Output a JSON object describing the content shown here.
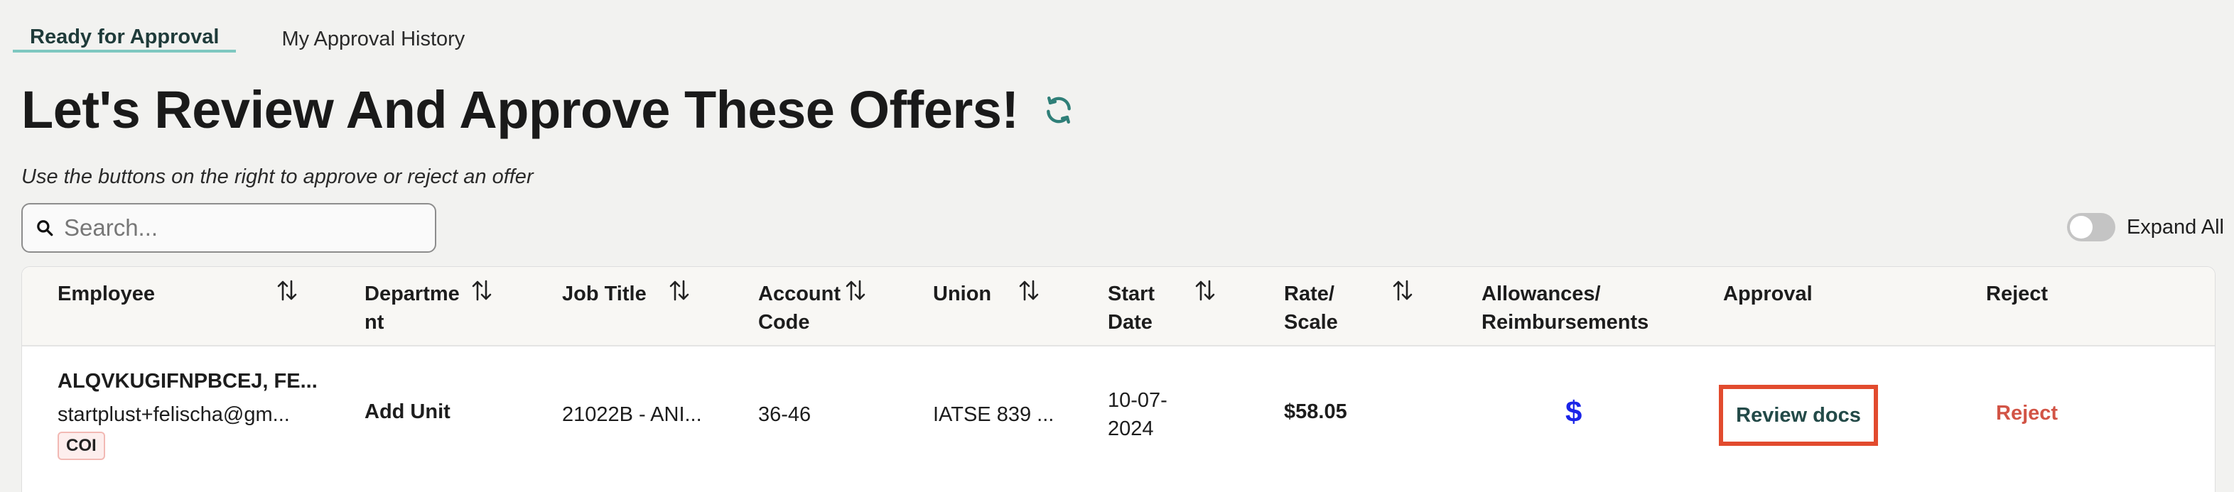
{
  "tabs": [
    {
      "label": "Ready for Approval",
      "active": true
    },
    {
      "label": "My Approval History",
      "active": false
    }
  ],
  "header": {
    "title": "Let's Review And Approve These Offers!",
    "subtitle": "Use the buttons on the right to approve or reject an offer",
    "refresh_icon": "refresh-icon"
  },
  "search": {
    "placeholder": "Search...",
    "value": "",
    "icon": "search-icon"
  },
  "expand_all": {
    "label": "Expand All",
    "on": false
  },
  "table": {
    "columns": [
      {
        "label": "Employee",
        "sortable": true
      },
      {
        "label": "Departme\nnt",
        "sortable": true
      },
      {
        "label": "Job Title",
        "sortable": true
      },
      {
        "label": "Account\nCode",
        "sortable": true
      },
      {
        "label": "Union",
        "sortable": true
      },
      {
        "label": "Start\nDate",
        "sortable": true
      },
      {
        "label": "Rate/\nScale",
        "sortable": true
      },
      {
        "label": "Allowances/\nReimbursements",
        "sortable": false
      },
      {
        "label": "Approval",
        "sortable": false
      },
      {
        "label": "Reject",
        "sortable": false
      }
    ],
    "rows": [
      {
        "employee_name": "ALQVKUGIFNPBCEJ, FE...",
        "employee_email": "startplust+felischa@gm...",
        "badge": "COI",
        "department": "Add Unit",
        "job_title": "21022B - ANI...",
        "account_code": "36-46",
        "union": "IATSE 839 ...",
        "start_date": "10-07-\n2024",
        "rate": "$58.05",
        "allowances_icon": "$",
        "approval_label": "Review docs",
        "reject_label": "Reject"
      }
    ]
  },
  "colors": {
    "accent_teal": "#7ec8c0",
    "review_border": "#e24b2e",
    "reject_text": "#d25446",
    "dollar_blue": "#1a24e8"
  }
}
